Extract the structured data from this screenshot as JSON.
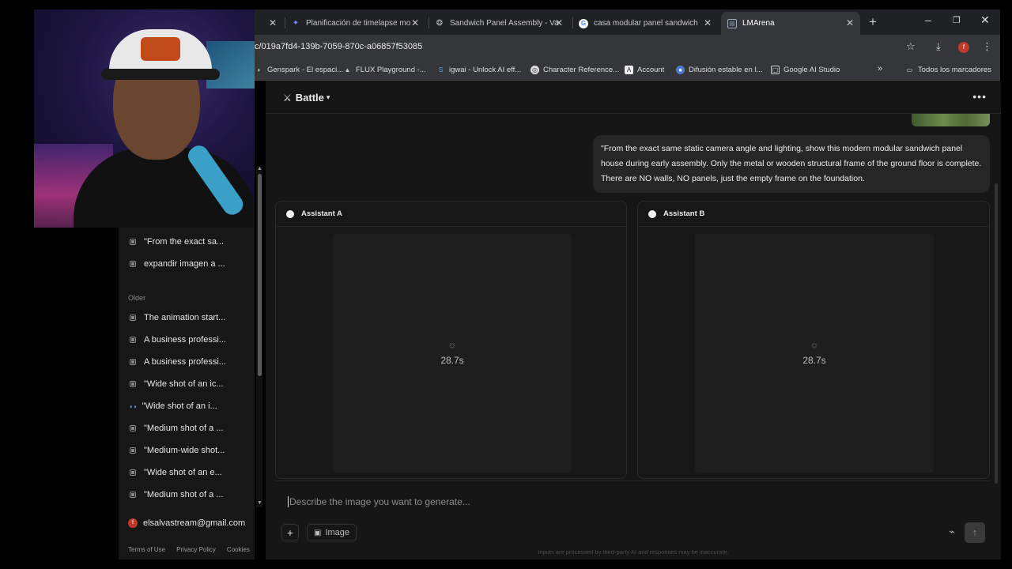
{
  "browser": {
    "tabs": [
      {
        "label": "",
        "icon": "blank-icon"
      },
      {
        "label": "Planificación de timelapse mo",
        "icon": "gemini-icon"
      },
      {
        "label": "Sandwich Panel Assembly - Va",
        "icon": "panel-icon"
      },
      {
        "label": "casa modular panel sandwich",
        "icon": "google-icon"
      },
      {
        "label": "LMArena",
        "icon": "lmarena-icon",
        "active": true
      }
    ],
    "new_tab": "+",
    "url": "c/019a7fd4-139b-7059-870c-a06857f53085",
    "profile_initial": "f",
    "bookmarks": [
      "Genspark - El espaci...",
      "FLUX Playground -...",
      "igwai - Unlock AI eff...",
      "Character Reference...",
      "Account",
      "Difusión estable en l...",
      "Google AI Studio"
    ],
    "bookmarks_overflow": "»",
    "all_bookmarks": "Todos los marcadores"
  },
  "sidebar": {
    "recent_items": [
      "\"From the exact sa...",
      "expandir imagen a ..."
    ],
    "older_heading": "Older",
    "older_items": [
      {
        "label": "The animation start...",
        "type": "image"
      },
      {
        "label": "A business professi...",
        "type": "image"
      },
      {
        "label": "A business professi...",
        "type": "image"
      },
      {
        "label": "\"Wide shot of an ic...",
        "type": "image"
      },
      {
        "label": "\"Wide shot of an i...",
        "type": "compare"
      },
      {
        "label": "\"Medium shot of a ...",
        "type": "image"
      },
      {
        "label": "\"Medium-wide shot...",
        "type": "image"
      },
      {
        "label": "\"Wide shot of an e...",
        "type": "image"
      },
      {
        "label": "\"Medium shot of a ...",
        "type": "image"
      }
    ],
    "user_email": "elsalvastream@gmail.com",
    "footer": [
      "Terms of Use",
      "Privacy Policy",
      "Cookies"
    ]
  },
  "main": {
    "mode_label": "Battle",
    "user_message": "\"From the exact same static camera angle and lighting, show this modern modular sandwich panel house during early assembly. Only the metal or wooden structural frame of the ground floor is complete. There are NO walls, NO panels, just the empty frame on the foundation.",
    "assistant_a": {
      "label": "Assistant A",
      "elapsed": "28.7s"
    },
    "assistant_b": {
      "label": "Assistant B",
      "elapsed": "28.7s"
    },
    "composer": {
      "placeholder": "Describe the image you want to generate...",
      "image_button": "Image"
    },
    "disclaimer": "Inputs are processed by third-party AI and responses may be inaccurate."
  }
}
